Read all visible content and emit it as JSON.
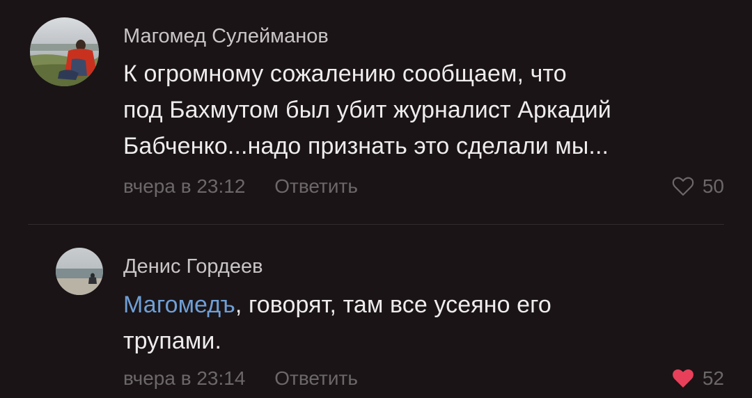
{
  "comments": [
    {
      "author": "Магомед Сулейманов",
      "mention": "",
      "text_lines": [
        "К огромному сожалению сообщаем,  что",
        "под Бахмутом был убит журналист Аркадий",
        "Бабченко...надо признать это сделали мы..."
      ],
      "time": "вчера в 23:12",
      "reply_label": "Ответить",
      "likes": "50",
      "liked": false,
      "avatar_icon": "person-on-hill-avatar"
    },
    {
      "author": "Денис Гордеев",
      "mention": "Магомедъ",
      "text_first": ", говорят, там все усеяно его",
      "text_second": "трупами.",
      "time": "вчера в 23:14",
      "reply_label": "Ответить",
      "likes": "52",
      "liked": true,
      "avatar_icon": "person-on-beach-avatar"
    }
  ],
  "colors": {
    "background": "#1a1416",
    "mention": "#6f9fd6",
    "heart_liked": "#e8405a",
    "meta": "#6c6769"
  }
}
